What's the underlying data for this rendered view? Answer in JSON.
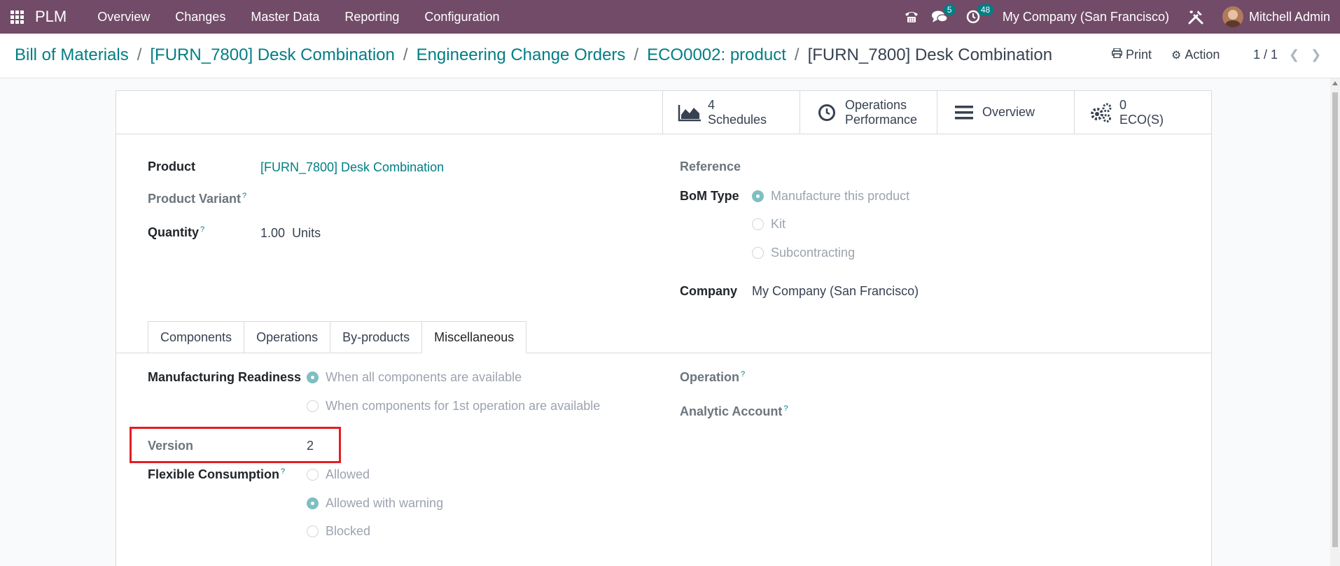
{
  "navbar": {
    "app_name": "PLM",
    "menu": [
      "Overview",
      "Changes",
      "Master Data",
      "Reporting",
      "Configuration"
    ],
    "messages_count": "5",
    "activities_count": "48",
    "company": "My Company (San Francisco)",
    "user": "Mitchell Admin",
    "icons": [
      "apps-grid-icon",
      "phone-icon",
      "chat-icon",
      "clock-icon",
      "tools-icon"
    ]
  },
  "breadcrumb": [
    "Bill of Materials",
    "[FURN_7800] Desk Combination",
    "Engineering Change Orders",
    "ECO0002: product",
    "[FURN_7800] Desk Combination"
  ],
  "actions": {
    "print": "Print",
    "action": "Action"
  },
  "pager": "1 / 1",
  "smart_buttons": [
    {
      "icon": "area-chart-icon",
      "line1": "4",
      "line2": "Schedules"
    },
    {
      "icon": "clock-icon",
      "line1": "Operations",
      "line2": "Performance"
    },
    {
      "icon": "bars-icon",
      "line1": "Overview",
      "line2": ""
    },
    {
      "icon": "gears-icon",
      "line1": "0",
      "line2": "ECO(S)"
    }
  ],
  "form": {
    "product_label": "Product",
    "product_value": "[FURN_7800] Desk Combination",
    "variant_label": "Product Variant",
    "quantity_label": "Quantity",
    "quantity_value": "1.00",
    "quantity_uom": "Units",
    "reference_label": "Reference",
    "bom_type_label": "BoM Type",
    "bom_type_options": [
      "Manufacture this product",
      "Kit",
      "Subcontracting"
    ],
    "bom_type_selected": "Manufacture this product",
    "company_label": "Company",
    "company_value": "My Company (San Francisco)"
  },
  "tabs": [
    "Components",
    "Operations",
    "By-products",
    "Miscellaneous"
  ],
  "active_tab": "Miscellaneous",
  "misc": {
    "readiness_label": "Manufacturing Readiness",
    "readiness_options": [
      "When all components are available",
      "When components for 1st operation are available"
    ],
    "readiness_selected": "When all components are available",
    "version_label": "Version",
    "version_value": "2",
    "flexible_label": "Flexible Consumption",
    "flexible_options": [
      "Allowed",
      "Allowed with warning",
      "Blocked"
    ],
    "flexible_selected": "Allowed with warning",
    "operation_label": "Operation",
    "analytic_label": "Analytic Account"
  },
  "colors": {
    "brand": "#714b67",
    "link": "#017e84",
    "highlight": "#e31e24"
  }
}
